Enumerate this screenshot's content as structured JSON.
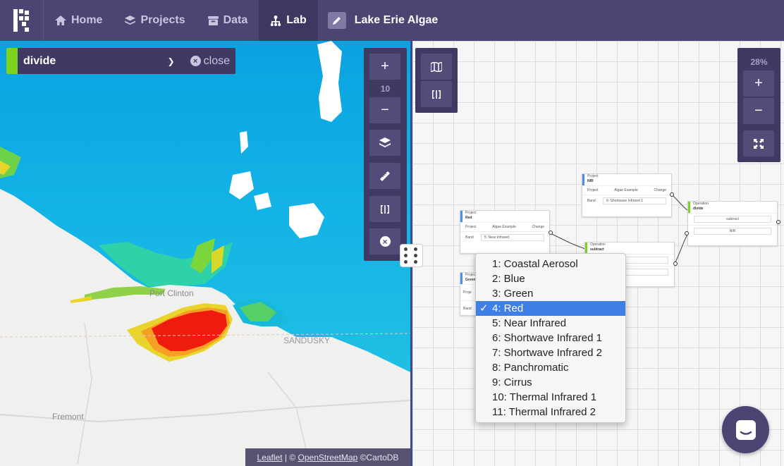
{
  "nav": {
    "items": [
      {
        "label": "Home",
        "icon": "home-icon"
      },
      {
        "label": "Projects",
        "icon": "layers-icon"
      },
      {
        "label": "Data",
        "icon": "database-icon"
      },
      {
        "label": "Lab",
        "icon": "lab-icon",
        "active": true
      }
    ],
    "project_title": "Lake Erie Algae"
  },
  "map": {
    "operation_name": "divide",
    "close_label": "close",
    "zoom_level": "10",
    "labels": [
      "Port Clinton",
      "SANDUSKY",
      "Fremont"
    ],
    "attribution": {
      "leaflet": "Leaflet",
      "sep": " | © ",
      "osm": "OpenStreetMap",
      "carto": " ©CartoDB"
    }
  },
  "diagram": {
    "zoom_percent": "28%",
    "nodes": {
      "nir": {
        "kind": "Project",
        "title": "NIR",
        "project_label": "Project",
        "project": "Algae Example",
        "change": "Change",
        "band_label": "Band",
        "band": "6: Shortwave Infrared 1"
      },
      "red": {
        "kind": "Project",
        "title": "Red",
        "project_label": "Project",
        "project": "Algae Example",
        "change": "Change",
        "band_label": "Band",
        "band": "5: Near Infrared"
      },
      "green": {
        "kind": "Project",
        "title": "Green",
        "project_label": "Proje",
        "band_label": "Band"
      },
      "subtract": {
        "kind": "Operation",
        "title": "subtract",
        "field1": "Green",
        "field2": "Red"
      },
      "divide": {
        "kind": "Operation",
        "title": "divide",
        "field1": "subtract",
        "field2": "NIR"
      }
    },
    "band_options": [
      "1: Coastal Aerosol",
      "2: Blue",
      "3: Green",
      "4: Red",
      "5: Near Infrared",
      "6: Shortwave Infrared 1",
      "7: Shortwave Infrared 2",
      "8: Panchromatic",
      "9: Cirrus",
      "10: Thermal Infrared 1",
      "11: Thermal Infrared 2"
    ],
    "selected_band": "4: Red",
    "check_mark": "✓"
  },
  "colors": {
    "nav_bg": "#4b4574",
    "accent_green": "#7ed321",
    "selection_blue": "#3f7fe6"
  }
}
